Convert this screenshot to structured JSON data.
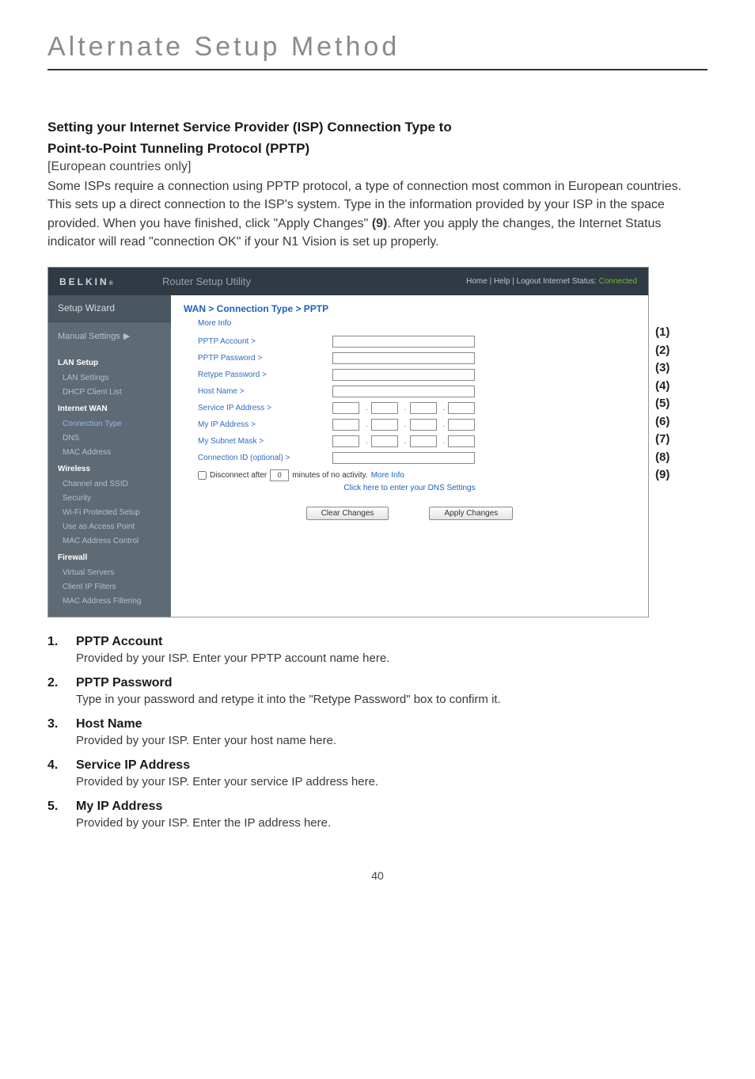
{
  "page": {
    "title": "Alternate Setup Method",
    "number": "40"
  },
  "section": {
    "heading_line1": "Setting your Internet Service Provider (ISP) Connection Type to",
    "heading_line2": "Point-to-Point Tunneling Protocol (PPTP)",
    "subnote": "[European countries only]",
    "body_pre": "Some ISPs require a connection using PPTP protocol, a type of connection most common in European countries. This sets up a direct connection to the ISP's system. Type in the information provided by your ISP in the space provided. When you have finished, click \"Apply Changes\" ",
    "body_ref": "(9)",
    "body_post": ". After you apply the changes, the Internet Status indicator will read \"connection OK\" if your N1 Vision is set up properly."
  },
  "screenshot": {
    "brand": "BELKIN",
    "brand_reg": "®",
    "utility_title": "Router Setup Utility",
    "links_prefix": "Home | Help | Logout   Internet Status: ",
    "status": "Connected",
    "sidebar": {
      "setup_wizard": "Setup Wizard",
      "manual_settings": "Manual Settings",
      "groups": [
        {
          "title": "LAN Setup",
          "items": [
            "LAN Settings",
            "DHCP Client List"
          ]
        },
        {
          "title": "Internet WAN",
          "items": [
            "Connection Type",
            "DNS",
            "MAC Address"
          ]
        },
        {
          "title": "Wireless",
          "items": [
            "Channel and SSID",
            "Security",
            "Wi-Fi Protected Setup",
            "Use as Access Point",
            "MAC Address Control"
          ]
        },
        {
          "title": "Firewall",
          "items": [
            "Virtual Servers",
            "Client IP Filters",
            "MAC Address Filtering"
          ]
        }
      ]
    },
    "content": {
      "breadcrumb": "WAN > Connection Type > PPTP",
      "more_info": "More Info",
      "fields": {
        "pptp_account": "PPTP Account >",
        "pptp_password": "PPTP Password >",
        "retype_password": "Retype Password >",
        "host_name": "Host Name >",
        "service_ip": "Service IP Address >",
        "my_ip": "My IP Address >",
        "subnet_mask": "My Subnet Mask >",
        "conn_id": "Connection ID (optional) >"
      },
      "disconnect_label": "Disconnect after",
      "disconnect_value": "0",
      "disconnect_suffix_a": "minutes of no activity.",
      "disconnect_suffix_link": "More Info",
      "dns_link": "Click here to enter your DNS Settings",
      "btn_clear": "Clear Changes",
      "btn_apply": "Apply Changes"
    },
    "callouts": [
      "(1)",
      "(2)",
      "(3)",
      "(4)",
      "(5)",
      "(6)",
      "(7)",
      "(8)",
      "(9)"
    ]
  },
  "list": [
    {
      "num": "1.",
      "title": "PPTP Account",
      "text": "Provided by your ISP. Enter your PPTP account name here."
    },
    {
      "num": "2.",
      "title": "PPTP Password",
      "text": "Type in your password and retype it into the \"Retype Password\" box to confirm it."
    },
    {
      "num": "3.",
      "title": "Host Name",
      "text": "Provided by your ISP. Enter your host name here."
    },
    {
      "num": "4.",
      "title": "Service IP Address",
      "text": "Provided by your ISP. Enter your service IP address here."
    },
    {
      "num": "5.",
      "title": "My IP Address",
      "text": "Provided by your ISP. Enter the IP address here."
    }
  ]
}
